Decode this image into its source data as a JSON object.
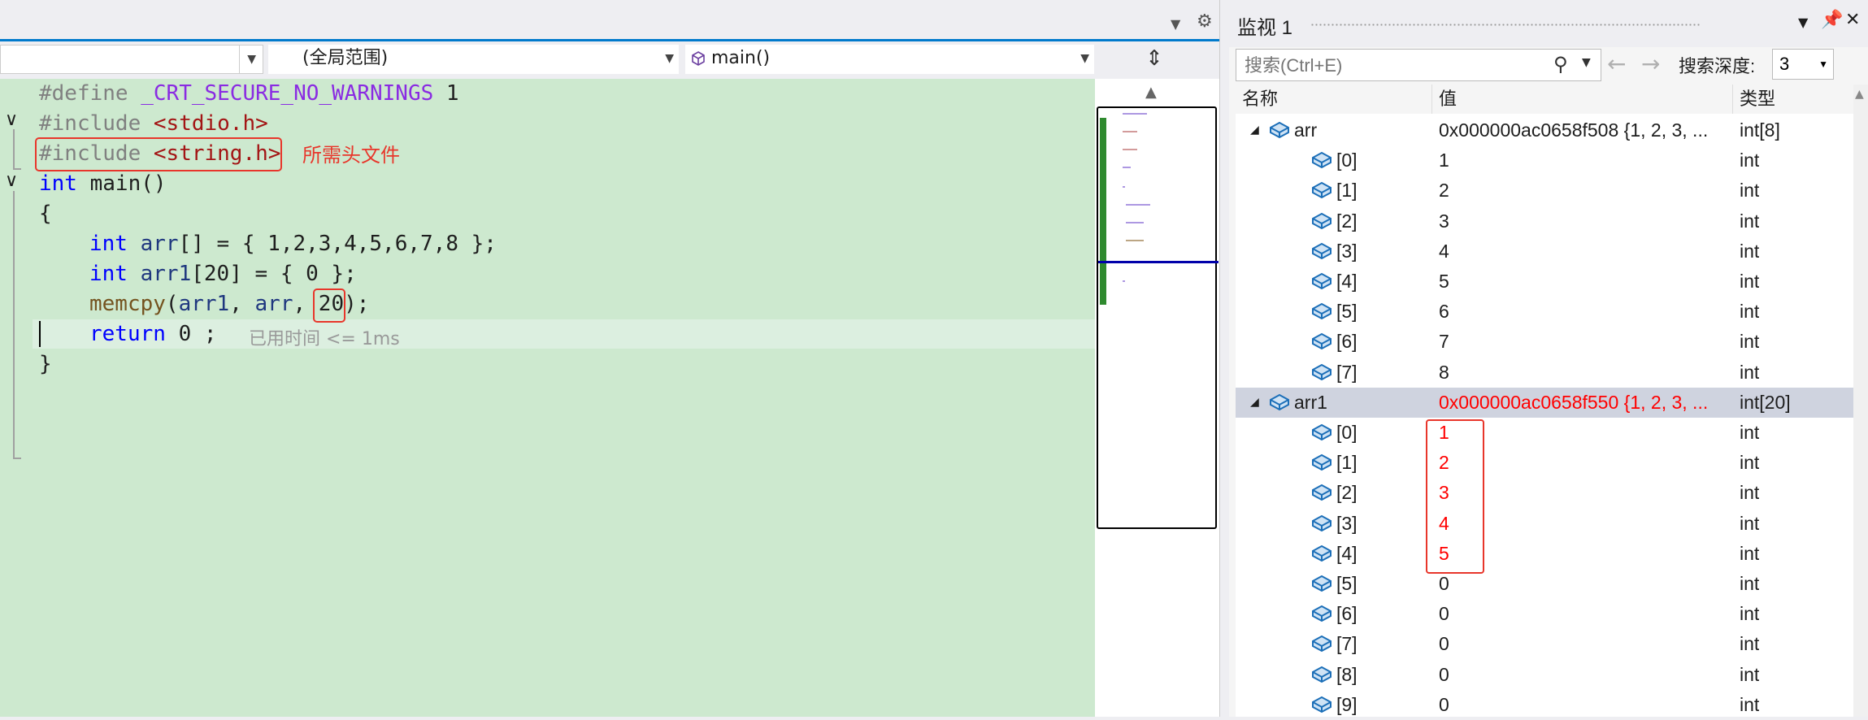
{
  "editor": {
    "nav": {
      "project_combo": "",
      "scope_combo": "(全局范围)",
      "function_combo": "main()"
    },
    "code_lines": [
      {
        "t": "#define _CRT_SECURE_NO_WARNINGS 1"
      },
      {
        "t": "#include <stdio.h>"
      },
      {
        "t": "#include <string.h>"
      },
      {
        "t": "int main()"
      },
      {
        "t": "{"
      },
      {
        "t": "int arr[] = { 1,2,3,4,5,6,7,8 };"
      },
      {
        "t": "int arr1[20] = { 0 };"
      },
      {
        "t": "memcpy(arr1, arr, 20);"
      },
      {
        "t": "return 0 ;"
      },
      {
        "t": "}"
      }
    ],
    "annotation_text": "所需头文件",
    "elapsed_text": "已用时间 <= 1ms"
  },
  "watch": {
    "title": "监视 1",
    "search_placeholder": "搜索(Ctrl+E)",
    "depth_label": "搜索深度:",
    "depth_value": "3",
    "columns": [
      "名称",
      "值",
      "类型"
    ],
    "rows": [
      {
        "name": "arr",
        "value": "0x000000ac0658f508 {1, 2, 3, ...",
        "type": "int[8]",
        "level": 0,
        "expanded": true
      },
      {
        "name": "[0]",
        "value": "1",
        "type": "int",
        "level": 1
      },
      {
        "name": "[1]",
        "value": "2",
        "type": "int",
        "level": 1
      },
      {
        "name": "[2]",
        "value": "3",
        "type": "int",
        "level": 1
      },
      {
        "name": "[3]",
        "value": "4",
        "type": "int",
        "level": 1
      },
      {
        "name": "[4]",
        "value": "5",
        "type": "int",
        "level": 1
      },
      {
        "name": "[5]",
        "value": "6",
        "type": "int",
        "level": 1
      },
      {
        "name": "[6]",
        "value": "7",
        "type": "int",
        "level": 1
      },
      {
        "name": "[7]",
        "value": "8",
        "type": "int",
        "level": 1
      },
      {
        "name": "arr1",
        "value": "0x000000ac0658f550 {1, 2, 3, ...",
        "type": "int[20]",
        "level": 0,
        "expanded": true,
        "changed": true,
        "selected": true
      },
      {
        "name": "[0]",
        "value": "1",
        "type": "int",
        "level": 1,
        "changed": true
      },
      {
        "name": "[1]",
        "value": "2",
        "type": "int",
        "level": 1,
        "changed": true
      },
      {
        "name": "[2]",
        "value": "3",
        "type": "int",
        "level": 1,
        "changed": true
      },
      {
        "name": "[3]",
        "value": "4",
        "type": "int",
        "level": 1,
        "changed": true
      },
      {
        "name": "[4]",
        "value": "5",
        "type": "int",
        "level": 1,
        "changed": true
      },
      {
        "name": "[5]",
        "value": "0",
        "type": "int",
        "level": 1
      },
      {
        "name": "[6]",
        "value": "0",
        "type": "int",
        "level": 1
      },
      {
        "name": "[7]",
        "value": "0",
        "type": "int",
        "level": 1
      },
      {
        "name": "[8]",
        "value": "0",
        "type": "int",
        "level": 1
      },
      {
        "name": "[9]",
        "value": "0",
        "type": "int",
        "level": 1
      }
    ]
  },
  "colors": {
    "editor_bg": "#cde9cf",
    "annotation_red": "#e8362b",
    "changed_value": "#ff0000",
    "accent": "#007acc"
  }
}
